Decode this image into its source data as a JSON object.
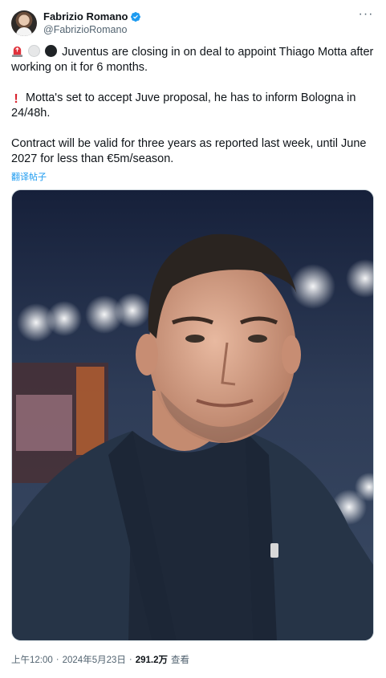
{
  "author": {
    "display_name": "Fabrizio Romano",
    "handle": "@FabrizioRomano",
    "avatar_icon": "avatar-photo",
    "verified_icon": "verified-badge-icon"
  },
  "tweet": {
    "line1_emojis": [
      "siren-emoji",
      "white-circle-emoji",
      "black-circle-emoji"
    ],
    "line1_text": "Juventus are closing in on deal to appoint Thiago Motta after working on it for 6 months.",
    "line2_emoji": "exclamation-emoji",
    "line2_text": "Motta's set to accept Juve proposal, he has to inform Bologna in 24/48h.",
    "line3_text": "Contract will be valid for three years as reported last week, until June 2027 for less than €5m/season.",
    "translate_label": "翻译帖子"
  },
  "media": {
    "description_icon": "photo-thiago-motta"
  },
  "meta": {
    "time": "上午12:00",
    "separator": "·",
    "date": "2024年5月23日",
    "views_count": "291.2万",
    "views_label": "查看"
  },
  "colors": {
    "accent": "#1d9bf0",
    "text": "#0f1419",
    "secondary": "#536471"
  }
}
